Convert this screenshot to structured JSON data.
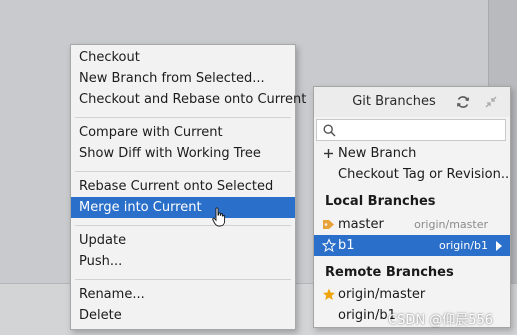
{
  "context_menu": {
    "items": [
      {
        "label": "Checkout"
      },
      {
        "label": "New Branch from Selected..."
      },
      {
        "label": "Checkout and Rebase onto Current"
      },
      {
        "label": "Compare with Current"
      },
      {
        "label": "Show Diff with Working Tree"
      },
      {
        "label": "Rebase Current onto Selected"
      },
      {
        "label": "Merge into Current",
        "selected": true
      },
      {
        "label": "Update"
      },
      {
        "label": "Push..."
      },
      {
        "label": "Rename..."
      },
      {
        "label": "Delete"
      }
    ]
  },
  "git_branches": {
    "title": "Git Branches",
    "search_placeholder": "",
    "actions": [
      {
        "label": "New Branch",
        "icon": "plus-icon"
      },
      {
        "label": "Checkout Tag or Revision..."
      }
    ],
    "local_header": "Local Branches",
    "local": [
      {
        "name": "master",
        "tracking": "origin/master",
        "icon": "tag-icon"
      },
      {
        "name": "b1",
        "tracking": "origin/b1",
        "icon": "star-outline-icon",
        "selected": true
      }
    ],
    "remote_header": "Remote Branches",
    "remote": [
      {
        "name": "origin/master",
        "icon": "star-icon"
      },
      {
        "name": "origin/b1"
      }
    ]
  },
  "watermark": "CSDN @仰晨556",
  "colors": {
    "selection": "#2a6fc9",
    "menu_bg": "#f2f2f2",
    "star": "#f0a30a"
  }
}
